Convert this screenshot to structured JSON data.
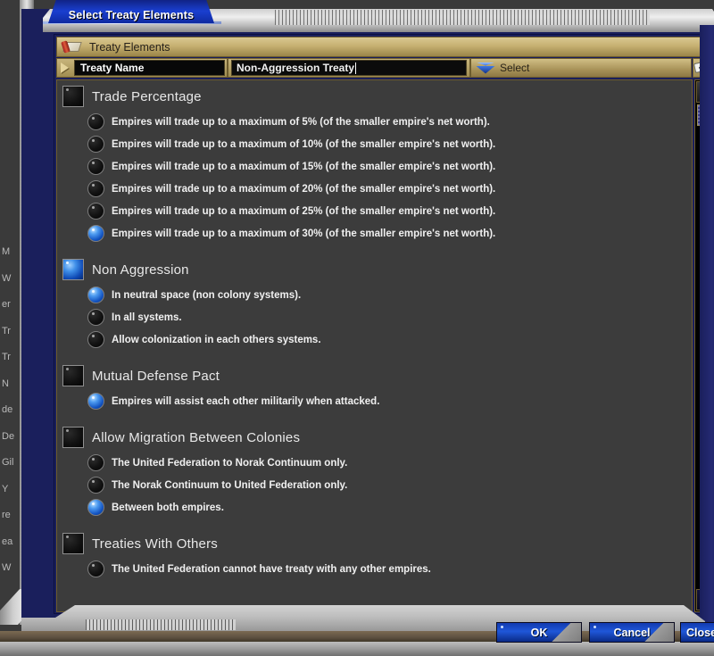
{
  "window": {
    "tab_title": "Select Treaty Elements",
    "panel_title": "Treaty Elements",
    "scroll_icon": "scroll-icon"
  },
  "name_row": {
    "label": "Treaty Name",
    "value": "Non-Aggression Treaty",
    "select_label": "Select",
    "select_icon": "chevron-down-icon",
    "random_icon": "dice-icon",
    "arrow_icon": "triangle-right-icon"
  },
  "groups": [
    {
      "title": "Trade Percentage",
      "checked": false,
      "options": [
        {
          "label": "Empires will trade up to a maximum of 5% (of the smaller empire's net worth).",
          "selected": false
        },
        {
          "label": "Empires will trade up to a maximum of 10% (of the smaller empire's net worth).",
          "selected": false
        },
        {
          "label": "Empires will trade up to a maximum of 15% (of the smaller empire's net worth).",
          "selected": false
        },
        {
          "label": "Empires will trade up to a maximum of 20% (of the smaller empire's net worth).",
          "selected": false
        },
        {
          "label": "Empires will trade up to a maximum of 25% (of the smaller empire's net worth).",
          "selected": false
        },
        {
          "label": "Empires will trade up to a maximum of 30% (of the smaller empire's net worth).",
          "selected": true
        }
      ]
    },
    {
      "title": "Non Aggression",
      "checked": true,
      "options": [
        {
          "label": "In neutral space (non colony systems).",
          "selected": true
        },
        {
          "label": "In all systems.",
          "selected": false
        },
        {
          "label": "Allow colonization in each others systems.",
          "selected": false
        }
      ]
    },
    {
      "title": "Mutual Defense Pact",
      "checked": false,
      "options": [
        {
          "label": "Empires will assist each other militarily when attacked.",
          "selected": true
        }
      ]
    },
    {
      "title": "Allow Migration Between Colonies",
      "checked": false,
      "options": [
        {
          "label": "The United Federation to Norak Continuum only.",
          "selected": false
        },
        {
          "label": "The Norak Continuum to United Federation only.",
          "selected": false
        },
        {
          "label": "Between both empires.",
          "selected": true
        }
      ]
    },
    {
      "title": "Treaties With Others",
      "checked": false,
      "options": [
        {
          "label": "The United Federation cannot have treaty with any other empires.",
          "selected": false
        }
      ]
    }
  ],
  "scrollbar": {
    "up_icon": "scroll-up-arrow-icon",
    "down_icon": "scroll-down-arrow-icon"
  },
  "buttons": {
    "ok": "OK",
    "cancel": "Cancel",
    "close": "Close"
  },
  "background_text_fragments": [
    "M",
    "W",
    "er",
    "Tr",
    "Tr",
    "",
    "N",
    "de",
    "De",
    "Gil",
    "Y",
    "re",
    "ea",
    "W"
  ],
  "colors": {
    "accent_blue": "#1f57d8",
    "gold": "#c6b071",
    "panel_bg": "#3c3c3c",
    "frame_navy": "#1a1f5c"
  }
}
